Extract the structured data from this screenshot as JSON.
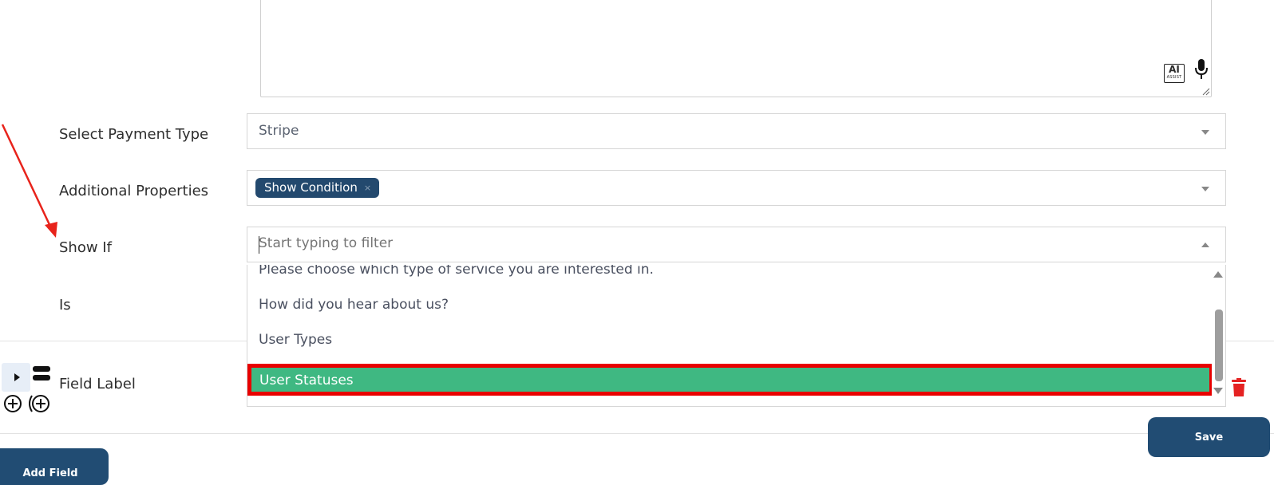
{
  "textarea": {
    "ai_badge_text": "AI",
    "ai_badge_subtext": "ASSIST",
    "icons": [
      "ai-assist-icon",
      "microphone-icon",
      "resize-grip-icon"
    ]
  },
  "form": {
    "payment_type": {
      "label": "Select Payment Type",
      "value": "Stripe"
    },
    "additional_properties": {
      "label": "Additional Properties",
      "chip": "Show Condition",
      "chip_remove": "×"
    },
    "show_if": {
      "label": "Show If",
      "placeholder": "Start typing to filter",
      "options": [
        "Please choose which type of service you are interested in.",
        "How did you hear about us?",
        "User Types",
        "User Statuses"
      ],
      "selected": "User Statuses"
    },
    "is": {
      "label": "Is"
    }
  },
  "field_row": {
    "label": "Field Label",
    "icons": [
      "expand-arrow-icon",
      "drag-handle-icon",
      "add-circle-icon",
      "add-condition-icon",
      "trash-icon"
    ]
  },
  "buttons": {
    "save": "Save",
    "add_field": "Add Field"
  },
  "colors": {
    "primary": "#214c73",
    "chip": "#23496e",
    "selected_option": "#3fb882",
    "highlight_border": "#e80000",
    "trash": "#e52222",
    "annotation_arrow": "#e8231b"
  }
}
